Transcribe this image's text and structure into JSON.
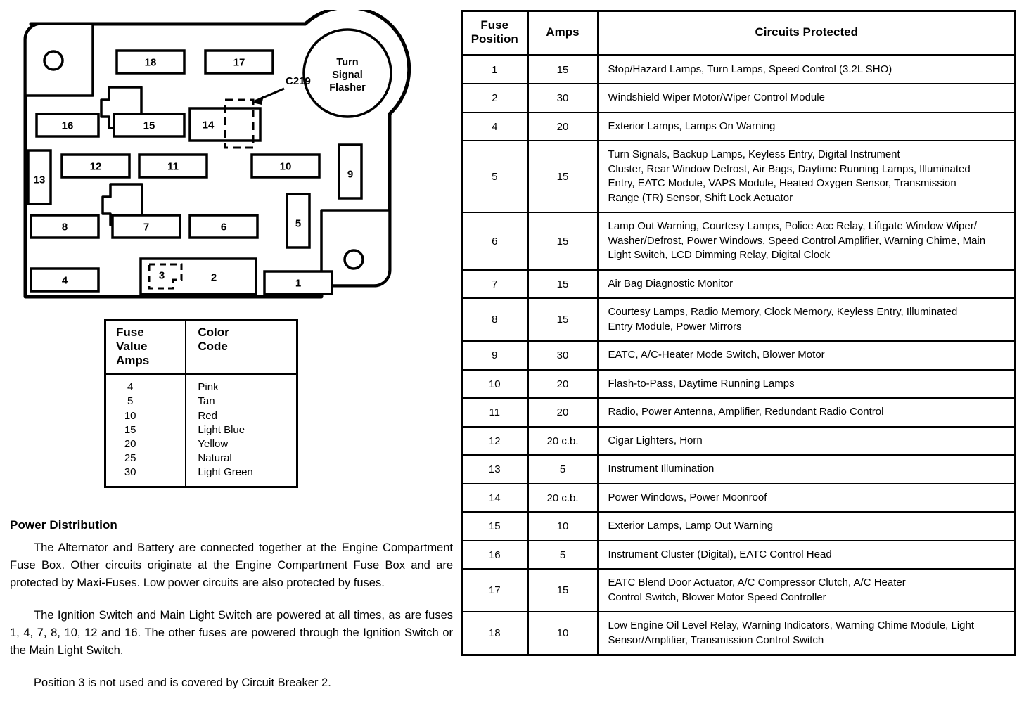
{
  "diagram": {
    "title": "engine-compartment-fuse-panel",
    "flasher_label_lines": [
      "Turn",
      "Signal",
      "Flasher"
    ],
    "connector_callout": "C219",
    "slots": [
      {
        "id": "18",
        "label": "18"
      },
      {
        "id": "17",
        "label": "17"
      },
      {
        "id": "16",
        "label": "16"
      },
      {
        "id": "15",
        "label": "15"
      },
      {
        "id": "14",
        "label": "14"
      },
      {
        "id": "13",
        "label": "13"
      },
      {
        "id": "12",
        "label": "12"
      },
      {
        "id": "11",
        "label": "11"
      },
      {
        "id": "10",
        "label": "10"
      },
      {
        "id": "9",
        "label": "9"
      },
      {
        "id": "8",
        "label": "8"
      },
      {
        "id": "7",
        "label": "7"
      },
      {
        "id": "6",
        "label": "6"
      },
      {
        "id": "5",
        "label": "5"
      },
      {
        "id": "4",
        "label": "4"
      },
      {
        "id": "3",
        "label": "3"
      },
      {
        "id": "2",
        "label": "2"
      },
      {
        "id": "1",
        "label": "1"
      }
    ]
  },
  "color_code_table": {
    "header": {
      "amps_lines": [
        "Fuse",
        "Value",
        "Amps"
      ],
      "color_lines": [
        "Color",
        "Code"
      ]
    },
    "rows": [
      {
        "amps": "4",
        "color": "Pink"
      },
      {
        "amps": "5",
        "color": "Tan"
      },
      {
        "amps": "10",
        "color": "Red"
      },
      {
        "amps": "15",
        "color": "Light Blue"
      },
      {
        "amps": "20",
        "color": "Yellow"
      },
      {
        "amps": "25",
        "color": "Natural"
      },
      {
        "amps": "30",
        "color": "Light Green"
      }
    ]
  },
  "power_distribution": {
    "heading": "Power Distribution",
    "paragraphs": [
      "The Alternator and Battery are connected together at the Engine Compartment Fuse Box. Other circuits originate at the Engine Compartment Fuse Box and are protected by Maxi-Fuses. Low power circuits are also protected by fuses.",
      "The Ignition Switch and Main Light Switch are powered at all times, as are fuses 1, 4, 7, 8, 10, 12 and 16. The other fuses are powered through the Ignition Switch or the Main Light Switch.",
      "Position 3 is not used and is covered by Circuit Breaker 2."
    ]
  },
  "fuse_table": {
    "columns": {
      "position_lines": [
        "Fuse",
        "Position"
      ],
      "amps": "Amps",
      "circuits": "Circuits Protected"
    },
    "rows": [
      {
        "position": "1",
        "amps": "15",
        "circuits": [
          "Stop/Hazard Lamps, Turn Lamps, Speed Control (3.2L SHO)"
        ]
      },
      {
        "position": "2",
        "amps": "30",
        "circuits": [
          "Windshield Wiper Motor/Wiper Control Module"
        ]
      },
      {
        "position": "4",
        "amps": "20",
        "circuits": [
          "Exterior Lamps, Lamps On Warning"
        ]
      },
      {
        "position": "5",
        "amps": "15",
        "circuits": [
          "Turn Signals, Backup Lamps, Keyless Entry, Digital Instrument",
          "Cluster, Rear Window Defrost, Air Bags, Daytime Running Lamps, Illuminated",
          "Entry, EATC Module, VAPS Module, Heated Oxygen Sensor, Transmission",
          "Range (TR) Sensor, Shift Lock Actuator"
        ]
      },
      {
        "position": "6",
        "amps": "15",
        "circuits": [
          "Lamp Out Warning, Courtesy Lamps, Police Acc Relay, Liftgate Window Wiper/",
          "Washer/Defrost, Power Windows, Speed Control Amplifier, Warning Chime, Main",
          "Light Switch, LCD Dimming Relay, Digital Clock"
        ]
      },
      {
        "position": "7",
        "amps": "15",
        "circuits": [
          "Air Bag Diagnostic Monitor"
        ]
      },
      {
        "position": "8",
        "amps": "15",
        "circuits": [
          "Courtesy Lamps, Radio Memory, Clock Memory, Keyless Entry, Illuminated",
          "Entry Module, Power Mirrors"
        ]
      },
      {
        "position": "9",
        "amps": "30",
        "circuits": [
          "EATC, A/C-Heater Mode Switch, Blower Motor"
        ]
      },
      {
        "position": "10",
        "amps": "20",
        "circuits": [
          "Flash-to-Pass, Daytime Running Lamps"
        ]
      },
      {
        "position": "11",
        "amps": "20",
        "circuits": [
          "Radio, Power Antenna, Amplifier, Redundant Radio Control"
        ]
      },
      {
        "position": "12",
        "amps": "20 c.b.",
        "circuits": [
          "Cigar Lighters, Horn"
        ]
      },
      {
        "position": "13",
        "amps": "5",
        "circuits": [
          "Instrument Illumination"
        ]
      },
      {
        "position": "14",
        "amps": "20 c.b.",
        "circuits": [
          "Power Windows, Power Moonroof"
        ]
      },
      {
        "position": "15",
        "amps": "10",
        "circuits": [
          "Exterior Lamps, Lamp Out Warning"
        ]
      },
      {
        "position": "16",
        "amps": "5",
        "circuits": [
          "Instrument Cluster (Digital), EATC Control Head"
        ]
      },
      {
        "position": "17",
        "amps": "15",
        "circuits": [
          "EATC Blend Door Actuator, A/C Compressor Clutch, A/C Heater",
          "Control Switch, Blower Motor Speed Controller"
        ]
      },
      {
        "position": "18",
        "amps": "10",
        "circuits": [
          "Low Engine Oil Level Relay, Warning Indicators, Warning Chime Module, Light",
          "Sensor/Amplifier, Transmission Control Switch"
        ]
      }
    ]
  }
}
